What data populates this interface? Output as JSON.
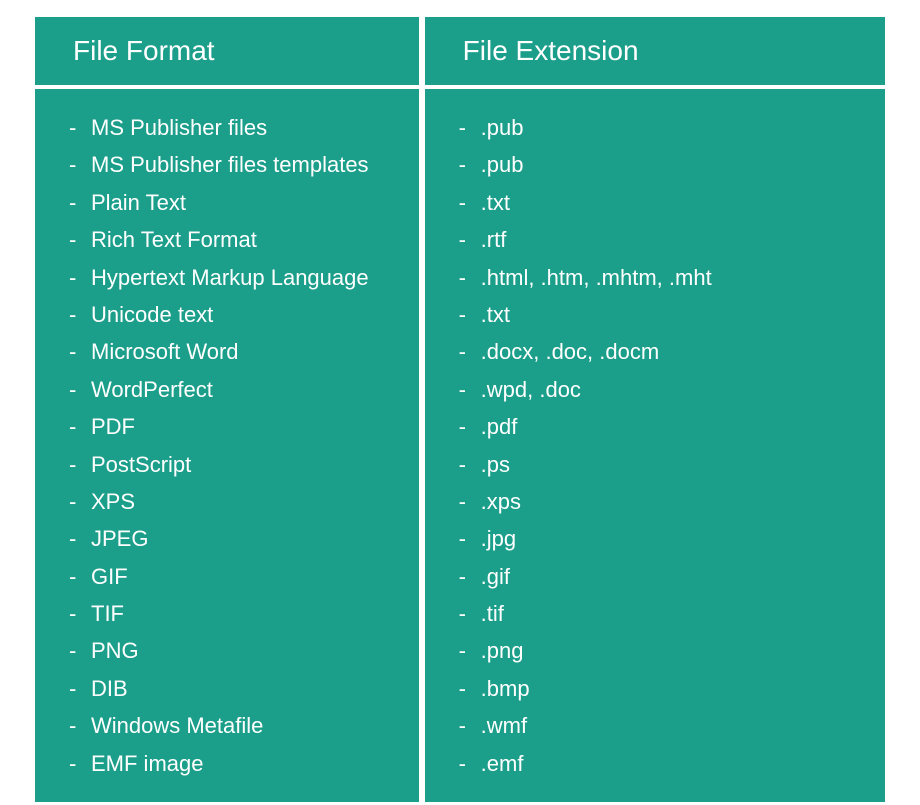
{
  "headers": {
    "format": "File Format",
    "extension": "File Extension"
  },
  "rows": [
    {
      "format": "MS Publisher files",
      "extension": ".pub"
    },
    {
      "format": "MS Publisher files templates",
      "extension": ".pub"
    },
    {
      "format": "Plain Text",
      "extension": ".txt"
    },
    {
      "format": "Rich Text Format",
      "extension": ".rtf"
    },
    {
      "format": "Hypertext Markup Language",
      "extension": ".html, .htm, .mhtm, .mht"
    },
    {
      "format": "Unicode text",
      "extension": ".txt"
    },
    {
      "format": "Microsoft Word",
      "extension": ".docx, .doc, .docm"
    },
    {
      "format": "WordPerfect",
      "extension": ".wpd, .doc"
    },
    {
      "format": "PDF",
      "extension": ".pdf"
    },
    {
      "format": "PostScript",
      "extension": ".ps"
    },
    {
      "format": "XPS",
      "extension": ".xps"
    },
    {
      "format": "JPEG",
      "extension": ".jpg"
    },
    {
      "format": "GIF",
      "extension": ".gif"
    },
    {
      "format": "TIF",
      "extension": ".tif"
    },
    {
      "format": "PNG",
      "extension": ".png"
    },
    {
      "format": "DIB",
      "extension": ".bmp"
    },
    {
      "format": "Windows Metafile",
      "extension": ".wmf"
    },
    {
      "format": "EMF image",
      "extension": ".emf"
    }
  ]
}
